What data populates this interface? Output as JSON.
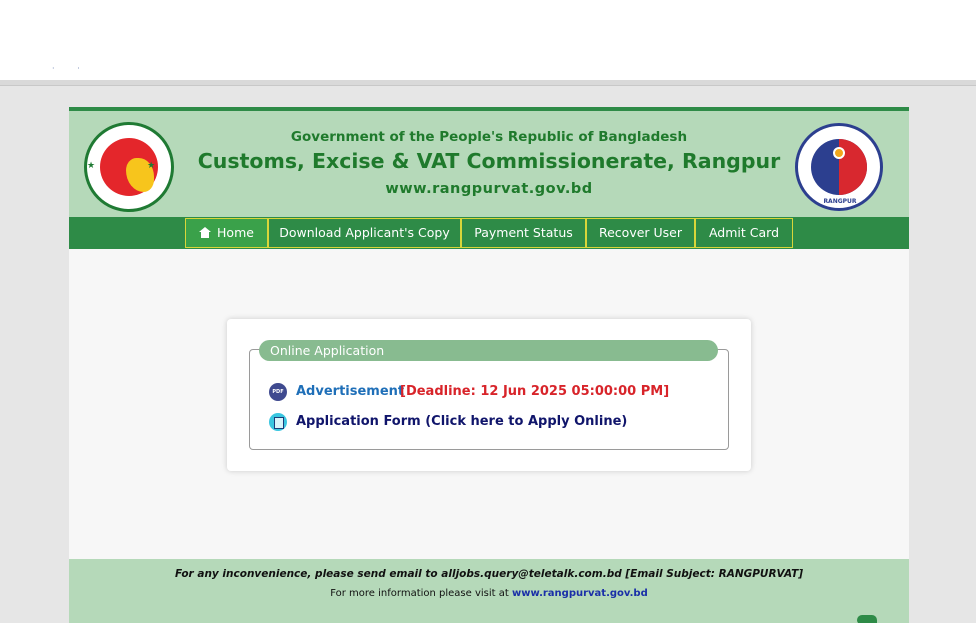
{
  "browser": {
    "status_dots": "·  ·"
  },
  "header": {
    "government": "Government of the People's Republic of Bangladesh",
    "title": "Customs, Excise & VAT Commissionerate, Rangpur",
    "website": "www.rangpurvat.gov.bd",
    "right_logo_label": "RANGPUR"
  },
  "nav": {
    "items": [
      {
        "label": "Home",
        "icon": "home-icon",
        "active": true
      },
      {
        "label": "Download Applicant's Copy"
      },
      {
        "label": "Payment Status"
      },
      {
        "label": "Recover User"
      },
      {
        "label": "Admit Card"
      }
    ]
  },
  "application": {
    "legend": "Online Application",
    "advertisement_label": "Advertisement",
    "deadline": "[Deadline: 12 Jun 2025 05:00:00 PM]",
    "apply_label": "Application Form (Click here to Apply Online)",
    "pdf_icon_text": "PDF"
  },
  "footer": {
    "notice": "For any inconvenience, please send email to alljobs.query@teletalk.com.bd [Email Subject: RANGPURVAT]",
    "more_info": "For more information please visit at",
    "link": "www.rangpurvat.gov.bd"
  },
  "colors": {
    "header_bg": "#b5d9b9",
    "nav_bg": "#2e8b47",
    "title_green": "#1f7a2c",
    "deadline_red": "#d8242a",
    "link_blue": "#1f6fb8"
  }
}
